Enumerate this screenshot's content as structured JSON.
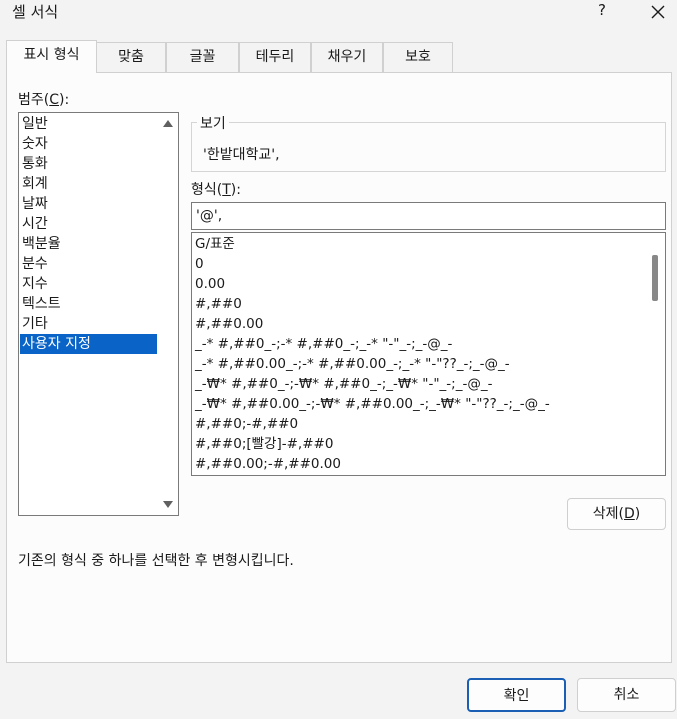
{
  "window": {
    "title": "셀 서식",
    "help_label": "?"
  },
  "tabs": [
    {
      "label": "표시 형식",
      "active": true
    },
    {
      "label": "맞춤",
      "active": false
    },
    {
      "label": "글꼴",
      "active": false
    },
    {
      "label": "테두리",
      "active": false
    },
    {
      "label": "채우기",
      "active": false
    },
    {
      "label": "보호",
      "active": false
    }
  ],
  "category": {
    "label": "범주(",
    "mnemonic": "C",
    "label_end": "):",
    "items": [
      "일반",
      "숫자",
      "통화",
      "회계",
      "날짜",
      "시간",
      "백분율",
      "분수",
      "지수",
      "텍스트",
      "기타",
      "사용자 지정"
    ],
    "selected_index": 11
  },
  "sample": {
    "legend": "보기",
    "value": "'한밭대학교',"
  },
  "format": {
    "label": "형식(",
    "mnemonic": "T",
    "label_end": "):",
    "value": "'@',",
    "items": [
      "G/표준",
      "0",
      "0.00",
      "#,##0",
      "#,##0.00",
      "_-* #,##0_-;-* #,##0_-;_-* \"-\"_-;_-@_-",
      "_-* #,##0.00_-;-* #,##0.00_-;_-* \"-\"??_-;_-@_-",
      "_-₩* #,##0_-;-₩* #,##0_-;_-₩* \"-\"_-;_-@_-",
      "_-₩* #,##0.00_-;-₩* #,##0.00_-;_-₩* \"-\"??_-;_-@_-",
      "#,##0;-#,##0",
      "#,##0;[빨강]-#,##0",
      "#,##0.00;-#,##0.00"
    ]
  },
  "buttons": {
    "delete_label": "삭제(",
    "delete_mnemonic": "D",
    "delete_end": ")",
    "ok_label": "확인",
    "cancel_label": "취소"
  },
  "description": "기존의 형식 중 하나를 선택한 후 변형시킵니다.",
  "colors": {
    "selection": "#0a64c8",
    "default_button_border": "#1a5fb4"
  }
}
